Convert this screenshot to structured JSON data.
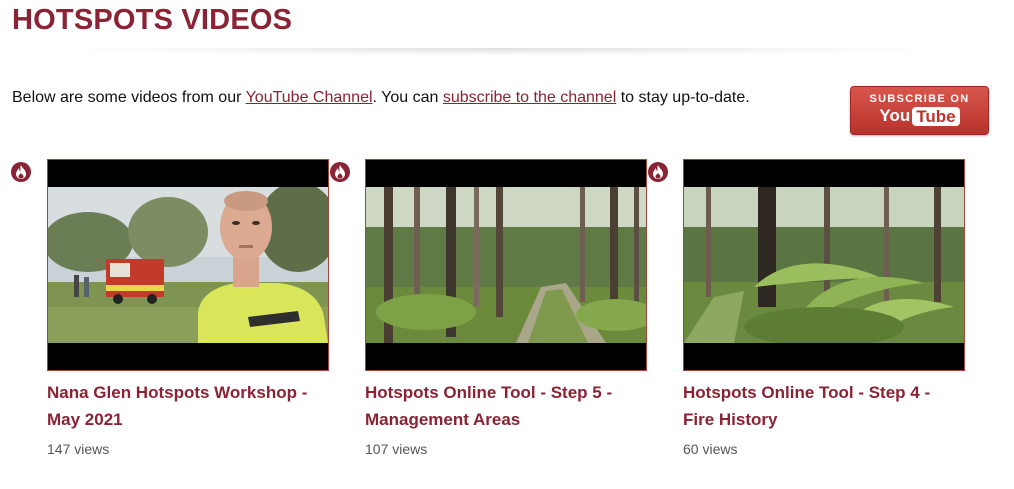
{
  "page": {
    "title": "HOTSPOTS VIDEOS"
  },
  "intro": {
    "text_before": "Below are some videos from our ",
    "channel_link": "YouTube Channel",
    "text_middle": ". You can ",
    "subscribe_link": "subscribe to the channel",
    "text_after": " to stay up-to-date."
  },
  "subscribe_button": {
    "line1": "SUBSCRIBE ON",
    "logo_you": "You",
    "logo_tube": "Tube"
  },
  "videos": [
    {
      "title": "Nana Glen Hotspots Workshop - May 2021",
      "views": "147 views",
      "thumbnail": "man-in-yellow-fire-jacket-with-fire-truck"
    },
    {
      "title": "Hotspots Online Tool - Step 5 - Management Areas",
      "views": "107 views",
      "thumbnail": "forest-track"
    },
    {
      "title": "Hotspots Online Tool - Step 4 - Fire History",
      "views": "60 views",
      "thumbnail": "forest-with-ferns"
    }
  ],
  "colors": {
    "accent": "#8a2333",
    "subscribe_red": "#c0332b",
    "thumb_border": "#a0463c"
  },
  "icons": {
    "badge": "flame-icon"
  }
}
